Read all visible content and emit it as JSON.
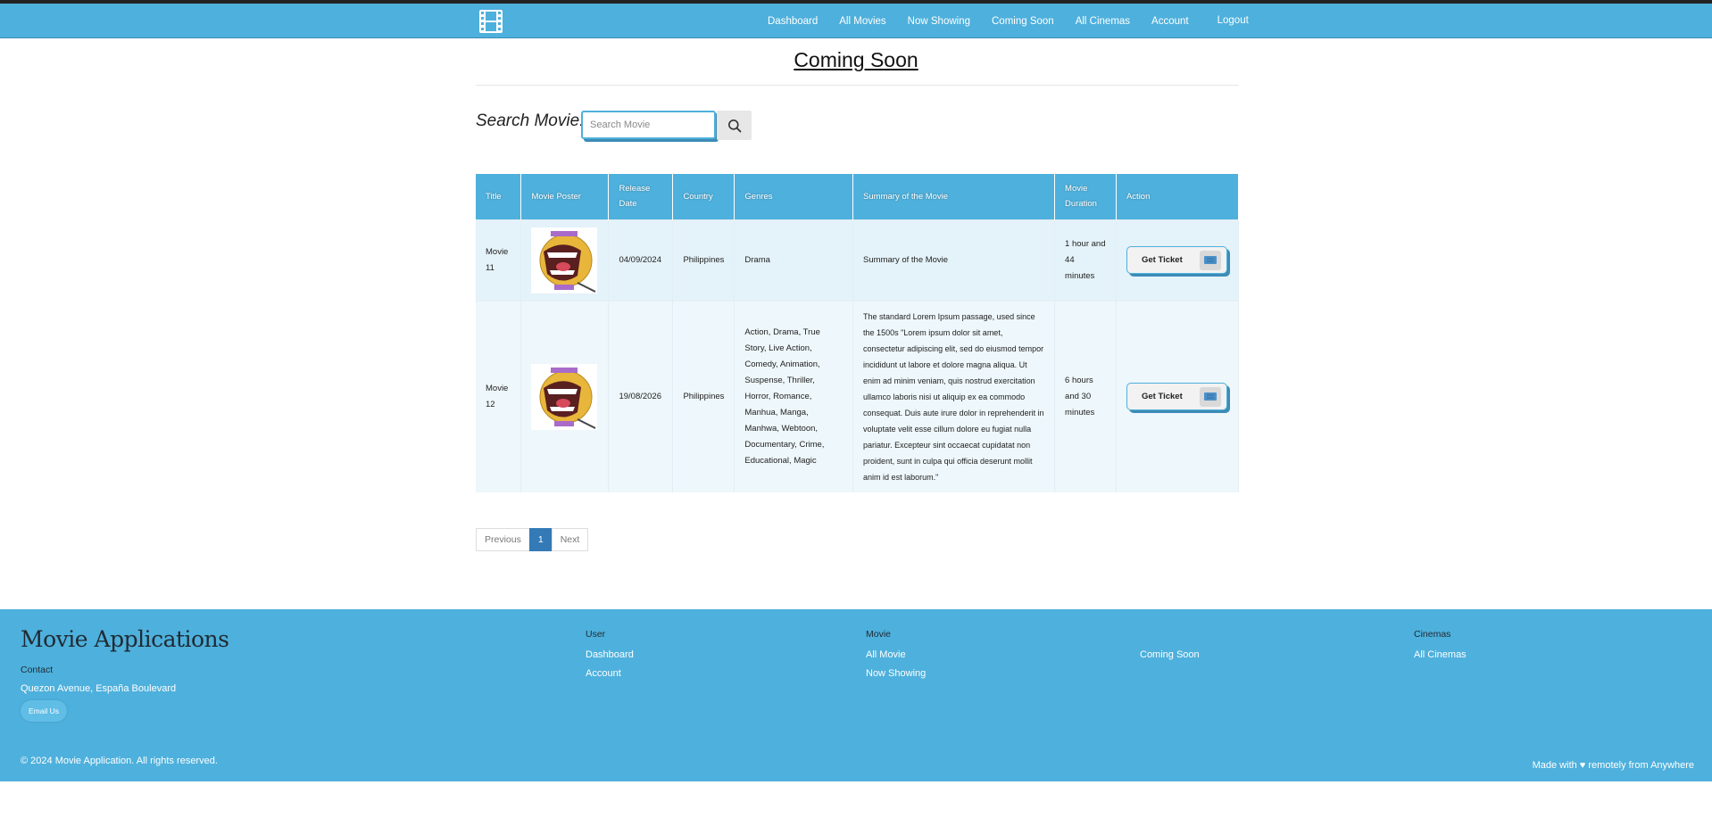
{
  "nav": {
    "logo_icon": "film-icon",
    "links": [
      "Dashboard",
      "All Movies",
      "Now Showing",
      "Coming Soon",
      "All Cinemas",
      "Account"
    ],
    "logout": "Logout"
  },
  "page": {
    "title": "Coming Soon"
  },
  "search": {
    "label": "Search Movie:",
    "placeholder": "Search Movie",
    "button_icon": "search-icon"
  },
  "table": {
    "headers": [
      "Title",
      "Movie Poster",
      "Release Date",
      "Country",
      "Genres",
      "Summary of the Movie",
      "Movie Duration",
      "Action"
    ],
    "rows": [
      {
        "title": "Movie 11",
        "release_date": "04/09/2024",
        "country": "Philippines",
        "genres": "Drama",
        "summary": "Summary of the Movie",
        "duration": "1 hour and 44 minutes",
        "action": "Get Ticket"
      },
      {
        "title": "Movie 12",
        "release_date": "19/08/2026",
        "country": "Philippines",
        "genres": "Action, Drama, True Story, Live Action, Comedy, Animation, Suspense, Thriller, Horror, Romance, Manhua, Manga, Manhwa, Webtoon, Documentary, Crime, Educational, Magic",
        "summary": "The standard Lorem Ipsum passage, used since the 1500s \"Lorem ipsum dolor sit amet, consectetur adipiscing elit, sed do eiusmod tempor incididunt ut labore et dolore magna aliqua. Ut enim ad minim veniam, quis nostrud exercitation ullamco laboris nisi ut aliquip ex ea commodo consequat. Duis aute irure dolor in reprehenderit in voluptate velit esse cillum dolore eu fugiat nulla pariatur. Excepteur sint occaecat cupidatat non proident, sunt in culpa qui officia deserunt mollit anim id est laborum.\"",
        "duration": "6 hours and 30 minutes",
        "action": "Get Ticket"
      }
    ]
  },
  "pagination": {
    "previous": "Previous",
    "current": "1",
    "next": "Next"
  },
  "footer": {
    "brand": "Movie Applications",
    "contact_label": "Contact",
    "address": "Quezon Avenue, España Boulevard",
    "email_button": "Email Us",
    "user_heading": "User",
    "user_links": [
      "Dashboard",
      "Account"
    ],
    "movie_heading": "Movie",
    "movie_links": [
      "All Movie",
      "Now Showing",
      "Coming Soon"
    ],
    "cinemas_heading": "Cinemas",
    "cinemas_links": [
      "All Cinemas"
    ],
    "copyright": "© 2024 Movie Application. All rights reserved.",
    "made_with": "Made with ♥ remotely from Anywhere"
  },
  "colors": {
    "brand": "#4eb0dc",
    "brand_dark": "#3d8cb5",
    "pagination_active": "#337ab7"
  }
}
